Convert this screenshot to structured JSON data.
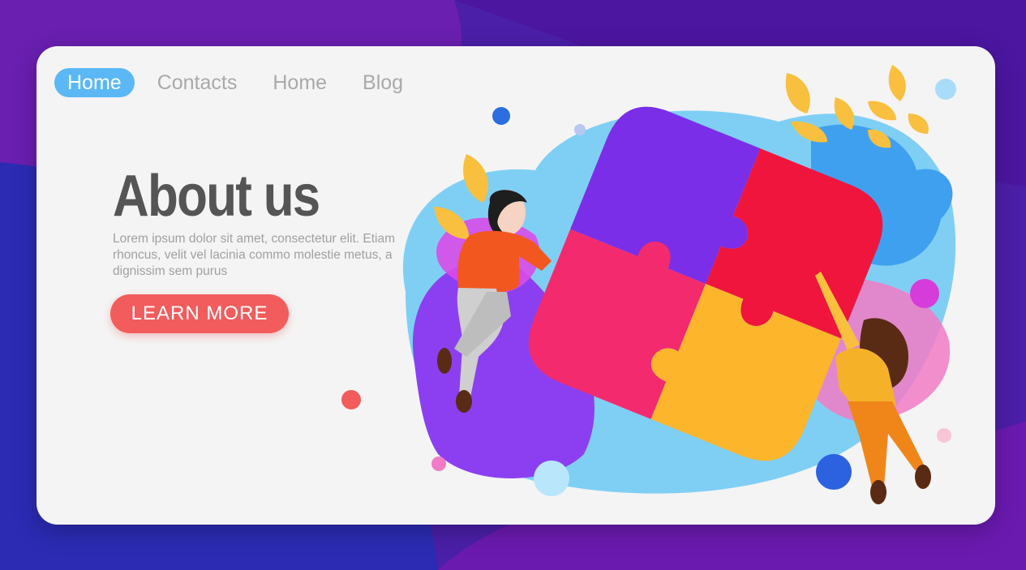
{
  "nav": {
    "items": [
      {
        "label": "Home",
        "active": true
      },
      {
        "label": "Contacts",
        "active": false
      },
      {
        "label": "Home",
        "active": false
      },
      {
        "label": "Blog",
        "active": false
      }
    ]
  },
  "hero": {
    "title": "About us",
    "description": "Lorem ipsum dolor sit amet, consectetur elit. Etiam rhoncus, velit vel lacinia commo molestie metus, a dignissim sem purus",
    "cta_label": "LEARN MORE"
  },
  "illustration": {
    "puzzle_colors": [
      "#7a2ee8",
      "#f0153d",
      "#f42a6e",
      "#fdb52c"
    ],
    "accent_blue": "#5bb8f5",
    "accent_red": "#f25c5c"
  }
}
